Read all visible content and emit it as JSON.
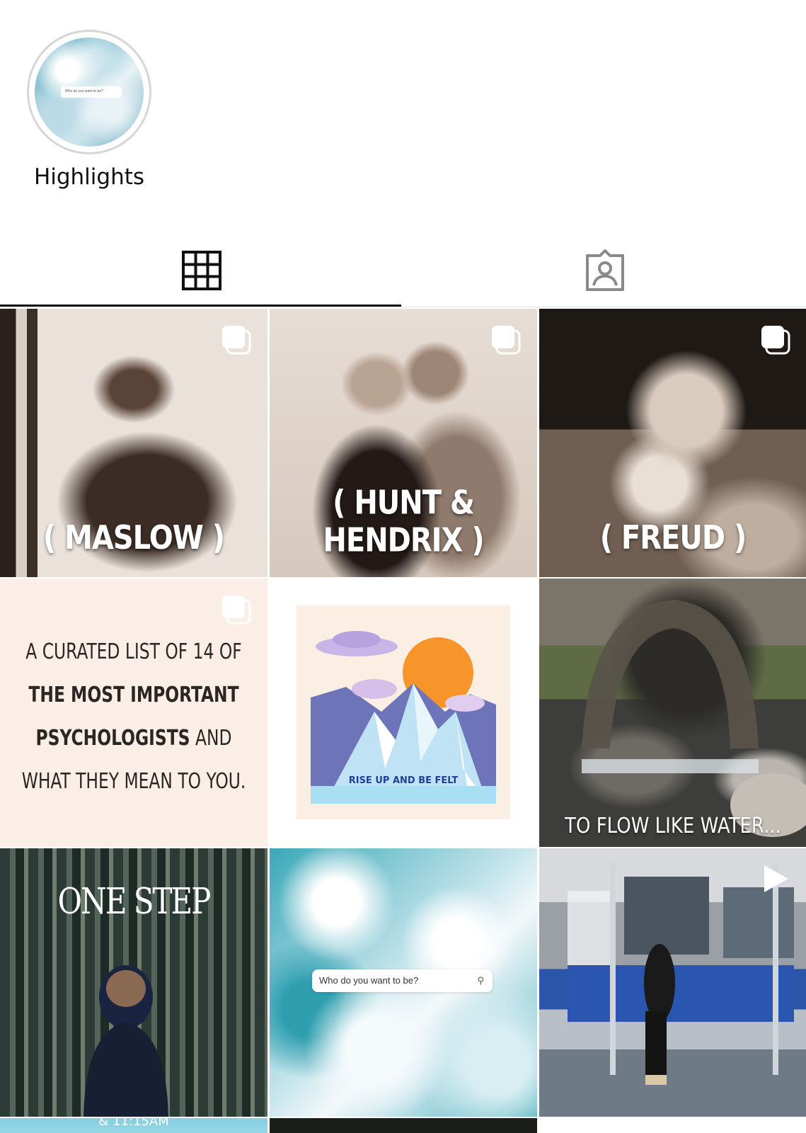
{
  "highlights": {
    "label": "Highlights",
    "search_text": "Who do you want to be?"
  },
  "tabs": [
    {
      "name": "grid",
      "icon": "grid-icon",
      "selected": true
    },
    {
      "name": "tagged",
      "icon": "tagged-person-icon",
      "selected": false
    }
  ],
  "posts": {
    "maslow": {
      "caption": "( MASLOW )",
      "multi": true
    },
    "hunt_hendrix": {
      "caption": "( HUNT & HENDRIX )",
      "multi": true
    },
    "freud": {
      "caption": "( FREUD )",
      "multi": true
    },
    "curated": {
      "line1": "A CURATED LIST OF 14 OF",
      "line2": "THE MOST IMPORTANT",
      "line3_bold": "PSYCHOLOGISTS",
      "line3_rest": " AND",
      "line4": "WHAT THEY MEAN TO YOU.",
      "multi": true
    },
    "rise_up": {
      "caption": "RISE UP AND BE FELT"
    },
    "water": {
      "caption": "TO FLOW LIKE WATER..."
    },
    "one_step": {
      "caption": "ONE STEP"
    },
    "ocean": {
      "search_text": "Who do you want to be?"
    },
    "subway": {
      "type": "video"
    },
    "partial_left": {
      "caption": "& 11:15AM"
    }
  },
  "colors": {
    "tab_active": "#111111",
    "tab_inactive": "#8a8a8a",
    "sun": "#f7942a",
    "mountain": "#6d74b8",
    "rise_text": "#1f3f99"
  }
}
